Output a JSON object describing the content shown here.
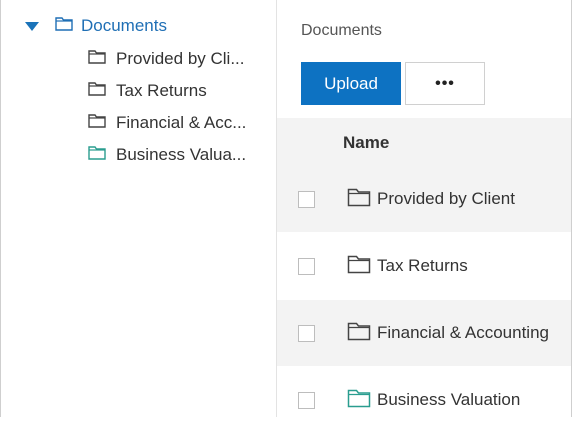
{
  "tree": {
    "root": {
      "label": "Documents",
      "icon": "folder-icon",
      "color": "#1f6fb5"
    },
    "items": [
      {
        "label": "Provided by Cli...",
        "icon": "folder-icon",
        "color": "#444444"
      },
      {
        "label": "Tax Returns",
        "icon": "folder-icon",
        "color": "#444444"
      },
      {
        "label": "Financial & Acc...",
        "icon": "folder-icon",
        "color": "#444444"
      },
      {
        "label": "Business Valua...",
        "icon": "folder-icon",
        "color": "#2a9d8f"
      }
    ]
  },
  "main": {
    "title": "Documents",
    "toolbar": {
      "upload_label": "Upload",
      "more_label": "•••"
    },
    "table": {
      "column_name": "Name",
      "rows": [
        {
          "name": "Provided by Client",
          "icon": "folder-icon",
          "color": "#444444"
        },
        {
          "name": "Tax Returns",
          "icon": "folder-icon",
          "color": "#444444"
        },
        {
          "name": "Financial & Accounting",
          "icon": "folder-icon",
          "color": "#444444"
        },
        {
          "name": "Business Valuation",
          "icon": "folder-icon",
          "color": "#2a9d8f"
        }
      ]
    }
  },
  "colors": {
    "accent": "#0d72c2",
    "row_alt": "#f3f3f3"
  }
}
